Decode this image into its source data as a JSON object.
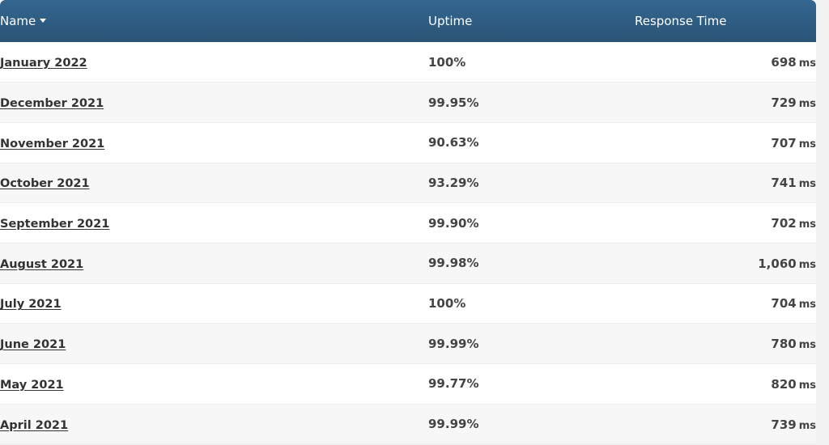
{
  "table": {
    "columns": [
      {
        "key": "name",
        "label": "Name",
        "sort_indicator": "▼",
        "sorted": true,
        "align": "left"
      },
      {
        "key": "uptime",
        "label": "Uptime",
        "sort_indicator": "",
        "sorted": false,
        "align": "left"
      },
      {
        "key": "resp",
        "label": "Response Time",
        "sort_indicator": "",
        "sorted": false,
        "align": "right"
      }
    ],
    "header_bg": "#2f5d83",
    "header_text_color": "#ffffff",
    "row_bg": "#ffffff",
    "row_alt_bg": "#f7f7f7",
    "link_color": "#333333",
    "value_color": "#444444",
    "rows": [
      {
        "name": "January 2022",
        "uptime": "100%",
        "resp_value": "698",
        "resp_unit": "ms"
      },
      {
        "name": "December 2021",
        "uptime": "99.95%",
        "resp_value": "729",
        "resp_unit": "ms"
      },
      {
        "name": "November 2021",
        "uptime": "90.63%",
        "resp_value": "707",
        "resp_unit": "ms"
      },
      {
        "name": "October 2021",
        "uptime": "93.29%",
        "resp_value": "741",
        "resp_unit": "ms"
      },
      {
        "name": "September 2021",
        "uptime": "99.90%",
        "resp_value": "702",
        "resp_unit": "ms"
      },
      {
        "name": "August 2021",
        "uptime": "99.98%",
        "resp_value": "1,060",
        "resp_unit": "ms"
      },
      {
        "name": "July 2021",
        "uptime": "100%",
        "resp_value": "704",
        "resp_unit": "ms"
      },
      {
        "name": "June 2021",
        "uptime": "99.99%",
        "resp_value": "780",
        "resp_unit": "ms"
      },
      {
        "name": "May 2021",
        "uptime": "99.77%",
        "resp_value": "820",
        "resp_unit": "ms"
      },
      {
        "name": "April 2021",
        "uptime": "99.99%",
        "resp_value": "739",
        "resp_unit": "ms"
      }
    ]
  }
}
